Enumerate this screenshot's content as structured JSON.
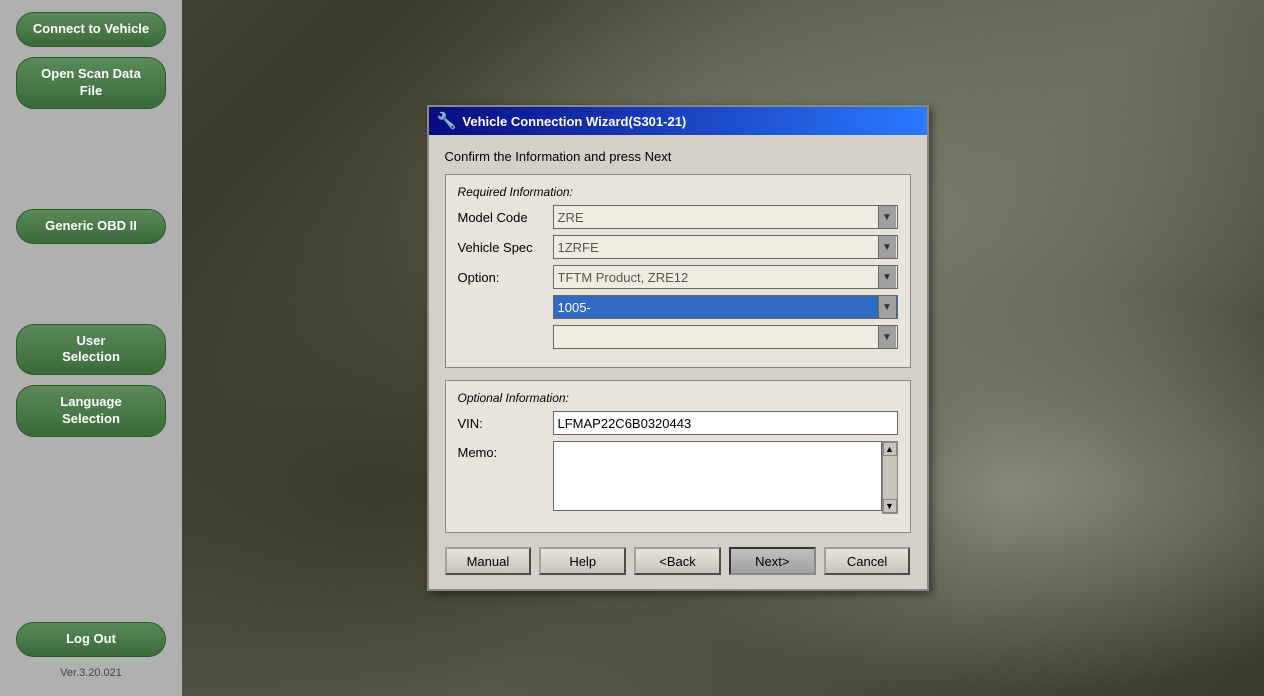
{
  "sidebar": {
    "buttons": [
      {
        "id": "connect-to-vehicle",
        "label": "Connect to Vehicle"
      },
      {
        "id": "open-scan-data-file",
        "label": "Open Scan Data File"
      },
      {
        "id": "generic-obd-ii",
        "label": "Generic OBD II"
      },
      {
        "id": "user-selection",
        "label": "User\nSelection"
      },
      {
        "id": "language-selection",
        "label": "Language\nSelection"
      },
      {
        "id": "log-out",
        "label": "Log Out"
      }
    ],
    "version": "Ver.3.20.021"
  },
  "dialog": {
    "title": "Vehicle Connection Wizard(S301-21)",
    "subtitle": "Confirm the Information and press Next",
    "required_section_label": "Required Information:",
    "fields": {
      "model_code": {
        "label": "Model Code",
        "value": "ZRE",
        "options": [
          "ZRE"
        ]
      },
      "vehicle_spec": {
        "label": "Vehicle Spec",
        "value": "1ZRFE",
        "options": [
          "1ZRFE"
        ]
      },
      "option": {
        "label": "Option:",
        "value": "TFTM Product, ZRE12",
        "options": [
          "TFTM Product, ZRE12"
        ]
      },
      "option_sub1": {
        "label": "",
        "value": "1005-",
        "options": [
          "1005-"
        ],
        "highlighted": true
      },
      "option_sub2": {
        "label": "",
        "value": "",
        "options": []
      }
    },
    "optional_section_label": "Optional Information:",
    "optional_fields": {
      "vin": {
        "label": "VIN:",
        "value": "LFMAP22C6B0320443"
      },
      "memo": {
        "label": "Memo:",
        "value": ""
      }
    },
    "buttons": {
      "manual": "Manual",
      "help": "Help",
      "back": "<Back",
      "next": "Next>",
      "cancel": "Cancel"
    }
  }
}
